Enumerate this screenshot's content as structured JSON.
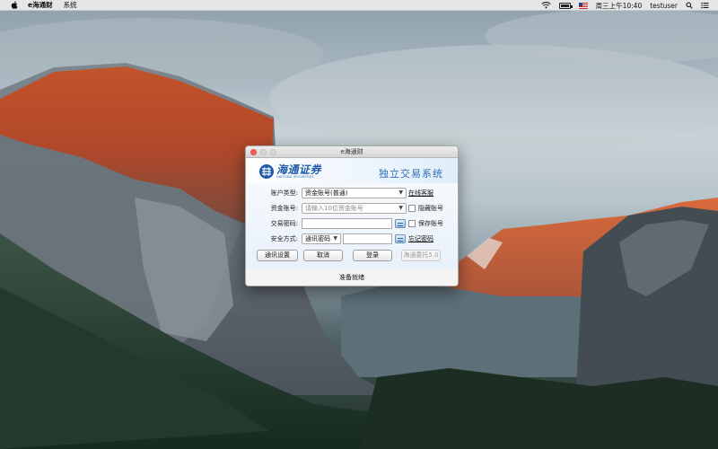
{
  "menubar": {
    "apple": "",
    "app_name": "e海通财",
    "menu_system": "系统",
    "datetime": "周三上午10:40",
    "user": "testuser"
  },
  "window": {
    "title": "e海通财",
    "logo_cn": "海通证券",
    "logo_en": "HAITONG SECURITIES",
    "banner_title": "独立交易系统",
    "account_type_label": "账户类型:",
    "account_type_value": "资金账号(普通)",
    "online_service_link": "在线客服",
    "fund_account_label": "资金账号:",
    "fund_account_placeholder": "请输入10位资金账号",
    "hide_account_label": "隐藏账号",
    "password_label": "交易密码:",
    "save_account_label": "保存账号",
    "security_label": "安全方式:",
    "security_value": "通讯密码",
    "forgot_password_link": "忘记密码",
    "btn_settings": "通讯设置",
    "btn_cancel": "取消",
    "btn_login": "登录",
    "btn_delegate": "海通委托5.0",
    "status": "准备就绪"
  },
  "colors": {
    "brand_blue": "#1e5aa8",
    "banner_title": "#2f6fb7",
    "close_red": "#fc5f57"
  },
  "icons": [
    "apple-icon",
    "wifi-icon",
    "battery-icon",
    "us-flag-icon",
    "search-icon",
    "menu-list-icon",
    "haitong-logo-icon",
    "keyboard-icon"
  ]
}
